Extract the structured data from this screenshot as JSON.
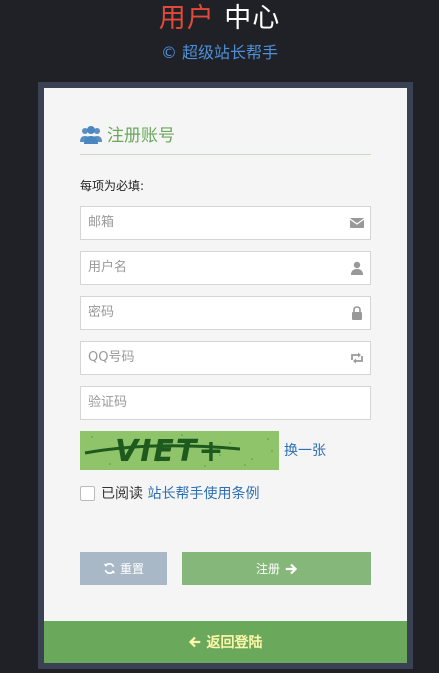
{
  "header": {
    "title_part1": "用户",
    "title_part2": "中心",
    "subtitle": "© 超级站长帮手"
  },
  "card": {
    "title": "注册账号",
    "title_icon": "users-icon",
    "required_note": "每项为必填:"
  },
  "form": {
    "email": {
      "placeholder": "邮箱",
      "icon": "envelope-icon"
    },
    "username": {
      "placeholder": "用户名",
      "icon": "user-icon"
    },
    "password": {
      "placeholder": "密码",
      "icon": "lock-icon"
    },
    "qq": {
      "placeholder": "QQ号码",
      "icon": "retweet-icon"
    },
    "captcha": {
      "placeholder": "验证码"
    },
    "captcha_text": "VIET+",
    "refresh_label": "换一张",
    "agree_prefix": "已阅读",
    "agree_link": "站长帮手使用条例"
  },
  "buttons": {
    "reset": "重置",
    "register": "注册",
    "back_login": "返回登陆"
  },
  "colors": {
    "background": "#1f2126",
    "frame": "#394152",
    "card": "#f5f5f5",
    "accent_green": "#6aa85c",
    "title_red": "#e04a3b",
    "link_blue": "#2f6fb5",
    "reset_button": "#a9b8c6",
    "register_button": "#86b77a"
  }
}
